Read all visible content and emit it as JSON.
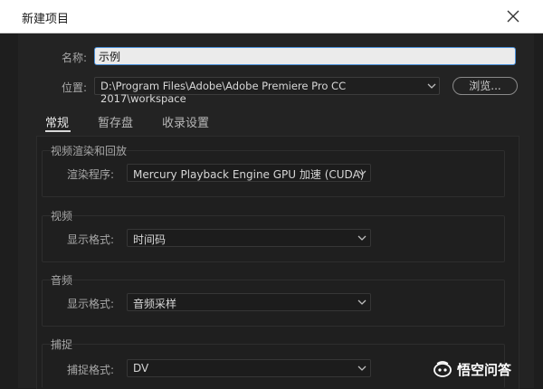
{
  "dialog": {
    "title": "新建项目"
  },
  "name_field": {
    "label": "名称:",
    "value": "示例"
  },
  "location": {
    "label": "位置:",
    "value": "D:\\Program Files\\Adobe\\Adobe Premiere Pro CC 2017\\workspace",
    "browse_label": "浏览..."
  },
  "tabs": [
    {
      "label": "常规",
      "active": true
    },
    {
      "label": "暂存盘",
      "active": false
    },
    {
      "label": "收录设置",
      "active": false
    }
  ],
  "sections": {
    "render": {
      "title": "视频渲染和回放",
      "field_label": "渲染程序:",
      "value": "Mercury Playback Engine GPU 加速 (CUDA)"
    },
    "video": {
      "title": "视频",
      "field_label": "显示格式:",
      "value": "时间码"
    },
    "audio": {
      "title": "音频",
      "field_label": "显示格式:",
      "value": "音频采样"
    },
    "capture": {
      "title": "捕捉",
      "field_label": "捕捉格式:",
      "value": "DV"
    }
  },
  "watermark": {
    "text": "悟空问答"
  },
  "colors": {
    "accent": "#4a90d9",
    "background": "#232323",
    "title_bar": "#ffffff"
  }
}
